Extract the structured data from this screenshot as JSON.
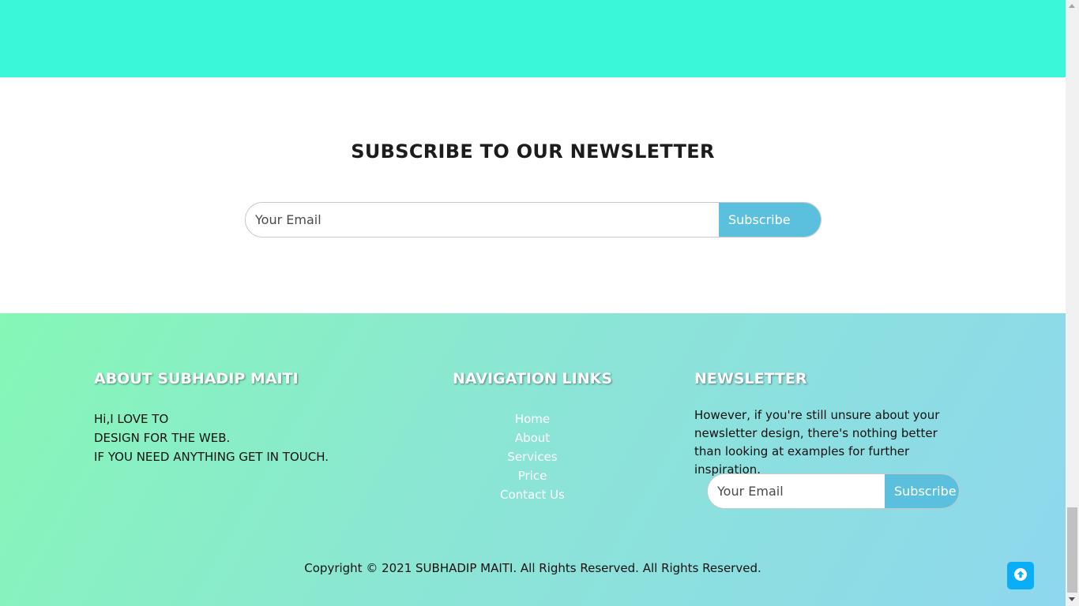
{
  "newsletter": {
    "title": "SUBSCRIBE TO OUR NEWSLETTER",
    "email_placeholder": "Your Email",
    "button_label": "Subscribe"
  },
  "footer": {
    "about": {
      "heading": "ABOUT SUBHADIP MAITI",
      "lines": [
        "Hi,I LOVE TO",
        "DESIGN FOR THE WEB.",
        "IF YOU NEED ANYTHING GET IN TOUCH."
      ]
    },
    "nav": {
      "heading": "NAVIGATION LINKS",
      "links": [
        "Home",
        "About",
        "Services",
        "Price",
        "Contact Us"
      ]
    },
    "newsletter": {
      "heading": "NEWSLETTER",
      "text": "However, if you're still unsure about your newsletter design, there's nothing better than looking at examples for further inspiration.",
      "email_placeholder": "Your Email",
      "button_label": "Subscribe"
    },
    "copyright": "Copyright © 2021 SUBHADIP MAITI. All Rights Reserved. All Rights Reserved."
  },
  "colors": {
    "top_band": "#3af7d9",
    "button": "#5bc0de",
    "back_to_top": "#0aaef7"
  },
  "icons": {
    "back_to_top": "arrow-up-icon"
  }
}
